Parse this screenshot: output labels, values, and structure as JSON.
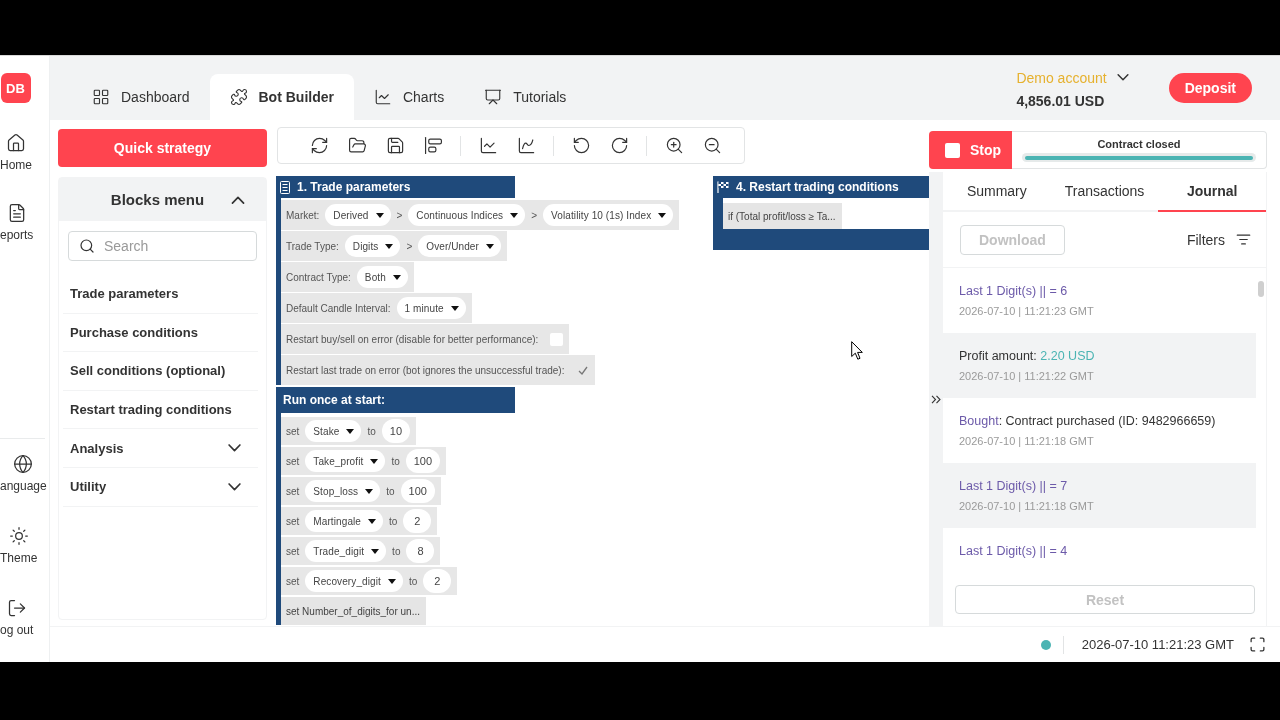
{
  "logo": "DB",
  "nav": {
    "top": [
      {
        "label": "Home"
      },
      {
        "label": "eports"
      }
    ],
    "bottom": [
      {
        "label": "anguage"
      },
      {
        "label": "Theme"
      },
      {
        "label": "og out"
      }
    ]
  },
  "tabs": [
    {
      "label": "Dashboard",
      "selected": false
    },
    {
      "label": "Bot Builder",
      "selected": true
    },
    {
      "label": "Charts",
      "selected": false
    },
    {
      "label": "Tutorials",
      "selected": false
    }
  ],
  "account": {
    "label": "Demo account",
    "balance": "4,856.01 USD"
  },
  "deposit_button": "Deposit",
  "quick_strategy_button": "Quick strategy",
  "blocks_menu": {
    "title": "Blocks menu",
    "expanded": true,
    "search": {
      "placeholder": "Search"
    },
    "items": [
      {
        "label": "Trade parameters"
      },
      {
        "label": "Purchase conditions"
      },
      {
        "label": "Sell conditions (optional)"
      },
      {
        "label": "Restart trading conditions"
      },
      {
        "label": "Analysis",
        "expanded": false
      },
      {
        "label": "Utility",
        "expanded": false
      }
    ]
  },
  "workspace": {
    "blocks": [
      {
        "title": "1. Trade parameters",
        "rows": [
          {
            "kind": "fields",
            "parts": [
              {
                "kind": "label",
                "text": "Market:"
              },
              {
                "kind": "dropdown",
                "text": "Derived"
              },
              {
                "kind": "separator",
                "text": ">"
              },
              {
                "kind": "dropdown",
                "text": "Continuous Indices"
              },
              {
                "kind": "separator",
                "text": ">"
              },
              {
                "kind": "dropdown",
                "text": "Volatility 10 (1s) Index"
              }
            ]
          },
          {
            "kind": "fields",
            "parts": [
              {
                "kind": "label",
                "text": "Trade Type:"
              },
              {
                "kind": "dropdown",
                "text": "Digits"
              },
              {
                "kind": "separator",
                "text": ">"
              },
              {
                "kind": "dropdown",
                "text": "Over/Under"
              }
            ]
          },
          {
            "kind": "fields",
            "parts": [
              {
                "kind": "label",
                "text": "Contract Type:"
              },
              {
                "kind": "dropdown",
                "text": "Both"
              }
            ]
          },
          {
            "kind": "fields",
            "parts": [
              {
                "kind": "label",
                "text": "Default Candle Interval:"
              },
              {
                "kind": "dropdown",
                "text": "1 minute"
              }
            ]
          },
          {
            "kind": "checkbox",
            "label": "Restart buy/sell on error (disable for better performance):",
            "checked": false
          },
          {
            "kind": "checkbox",
            "label": "Restart last trade on error (bot ignores the unsuccessful trade):",
            "checked": true
          }
        ],
        "sections": [
          {
            "title": "Run once at start:",
            "rows": [
              {
                "kind": "fields",
                "parts": [
                  {
                    "kind": "label",
                    "text": "set"
                  },
                  {
                    "kind": "dropdown",
                    "text": "Stake"
                  },
                  {
                    "kind": "label",
                    "text": "to"
                  },
                  {
                    "kind": "number",
                    "text": "10"
                  }
                ]
              },
              {
                "kind": "fields",
                "parts": [
                  {
                    "kind": "label",
                    "text": "set"
                  },
                  {
                    "kind": "dropdown",
                    "text": "Take_profit"
                  },
                  {
                    "kind": "label",
                    "text": "to"
                  },
                  {
                    "kind": "number",
                    "text": "100"
                  }
                ]
              },
              {
                "kind": "fields",
                "parts": [
                  {
                    "kind": "label",
                    "text": "set"
                  },
                  {
                    "kind": "dropdown",
                    "text": "Stop_loss"
                  },
                  {
                    "kind": "label",
                    "text": "to"
                  },
                  {
                    "kind": "number",
                    "text": "100"
                  }
                ]
              },
              {
                "kind": "fields",
                "parts": [
                  {
                    "kind": "label",
                    "text": "set"
                  },
                  {
                    "kind": "dropdown",
                    "text": "Martingale"
                  },
                  {
                    "kind": "label",
                    "text": "to"
                  },
                  {
                    "kind": "number",
                    "text": "2"
                  }
                ]
              },
              {
                "kind": "fields",
                "parts": [
                  {
                    "kind": "label",
                    "text": "set"
                  },
                  {
                    "kind": "dropdown",
                    "text": "Trade_digit"
                  },
                  {
                    "kind": "label",
                    "text": "to"
                  },
                  {
                    "kind": "number",
                    "text": "8"
                  }
                ]
              },
              {
                "kind": "fields",
                "parts": [
                  {
                    "kind": "label",
                    "text": "set"
                  },
                  {
                    "kind": "dropdown",
                    "text": "Recovery_digit"
                  },
                  {
                    "kind": "label",
                    "text": "to"
                  },
                  {
                    "kind": "number",
                    "text": "2"
                  }
                ]
              },
              {
                "kind": "collapsed",
                "text": "set Number_of_digits_for un..."
              }
            ]
          }
        ]
      },
      {
        "title": "4. Restart trading conditions",
        "rows": [
          {
            "kind": "collapsed",
            "text": "if (Total profit/loss ≥ Ta..."
          }
        ]
      }
    ]
  },
  "run_panel": {
    "stop_button": "Stop",
    "status": "Contract closed",
    "progress": {
      "level": 1
    }
  },
  "run_tabs": [
    {
      "label": "Summary",
      "selected": false
    },
    {
      "label": "Transactions",
      "selected": false
    },
    {
      "label": "Journal",
      "selected": true
    }
  ],
  "journal": {
    "download_button": {
      "label": "Download",
      "disabled": true
    },
    "filters": "Filters",
    "entries": [
      {
        "message": [
          {
            "kind": "event",
            "text": "Last 1 Digit(s) || = 6"
          }
        ],
        "time": "2026-07-10 | 11:21:23 GMT"
      },
      {
        "message": [
          {
            "kind": "plain",
            "text": "Profit amount: "
          },
          {
            "kind": "profit",
            "text": "2.20 USD"
          }
        ],
        "time": "2026-07-10 | 11:21:22 GMT"
      },
      {
        "message": [
          {
            "kind": "event",
            "text": "Bought"
          },
          {
            "kind": "plain",
            "text": ": Contract purchased (ID: 9482966659)"
          }
        ],
        "time": "2026-07-10 | 11:21:18 GMT"
      },
      {
        "message": [
          {
            "kind": "event",
            "text": "Last 1 Digit(s) || = 7"
          }
        ],
        "time": "2026-07-10 | 11:21:18 GMT"
      },
      {
        "message": [
          {
            "kind": "event",
            "text": "Last 1 Digit(s) || = 4"
          }
        ]
      }
    ],
    "reset_button": {
      "label": "Reset",
      "disabled": true
    }
  },
  "status_bar": {
    "connected": true,
    "time": "2026-07-10 11:21:23 GMT"
  }
}
